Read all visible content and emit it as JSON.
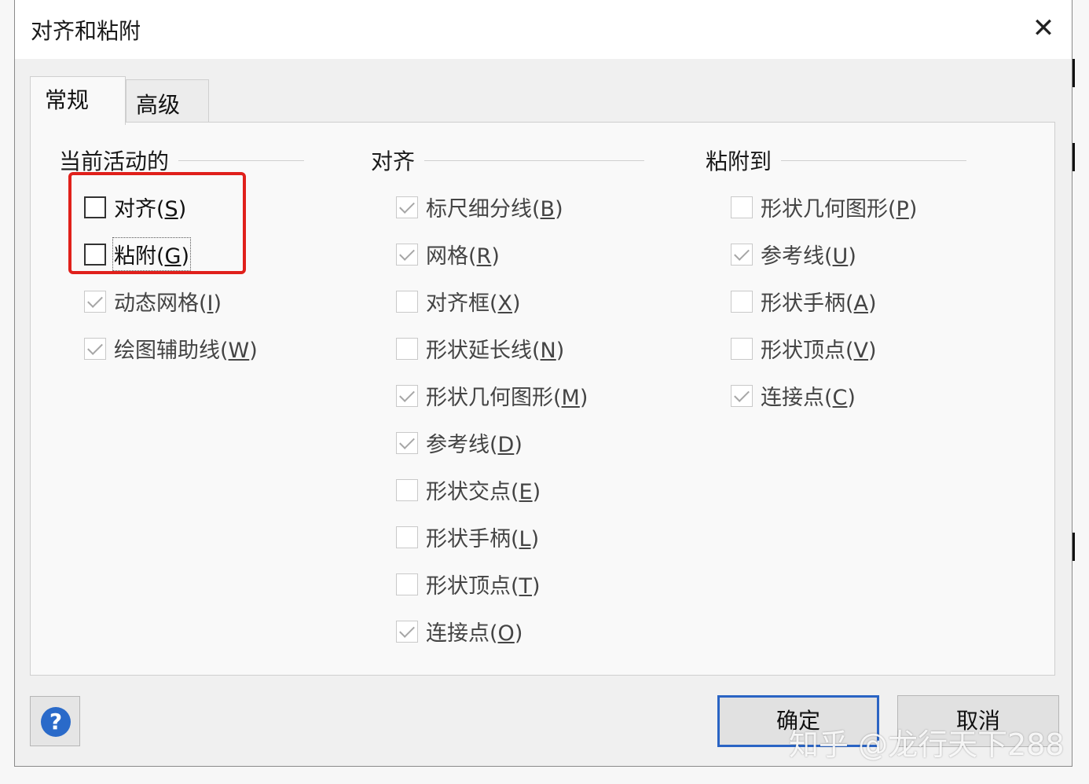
{
  "dialog": {
    "title": "对齐和粘附",
    "close_glyph": "✕"
  },
  "tabs": [
    {
      "label": "常规",
      "active": true
    },
    {
      "label": "高级",
      "active": false
    }
  ],
  "groups": {
    "current": {
      "header": "当前活动的",
      "items": [
        {
          "label": "对齐",
          "key": "S",
          "checked": false
        },
        {
          "label": "粘附",
          "key": "G",
          "checked": false
        },
        {
          "label": "动态网格",
          "key": "I",
          "checked": true
        },
        {
          "label": "绘图辅助线",
          "key": "W",
          "checked": true
        }
      ]
    },
    "align": {
      "header": "对齐",
      "items": [
        {
          "label": "标尺细分线",
          "key": "B",
          "checked": true
        },
        {
          "label": "网格",
          "key": "R",
          "checked": true
        },
        {
          "label": "对齐框",
          "key": "X",
          "checked": false
        },
        {
          "label": "形状延长线",
          "key": "N",
          "checked": false
        },
        {
          "label": "形状几何图形",
          "key": "M",
          "checked": true
        },
        {
          "label": "参考线",
          "key": "D",
          "checked": true
        },
        {
          "label": "形状交点",
          "key": "E",
          "checked": false
        },
        {
          "label": "形状手柄",
          "key": "L",
          "checked": false
        },
        {
          "label": "形状顶点",
          "key": "T",
          "checked": false
        },
        {
          "label": "连接点",
          "key": "O",
          "checked": true
        }
      ]
    },
    "glue": {
      "header": "粘附到",
      "items": [
        {
          "label": "形状几何图形",
          "key": "P",
          "checked": false
        },
        {
          "label": "参考线",
          "key": "U",
          "checked": true
        },
        {
          "label": "形状手柄",
          "key": "A",
          "checked": false
        },
        {
          "label": "形状顶点",
          "key": "V",
          "checked": false
        },
        {
          "label": "连接点",
          "key": "C",
          "checked": true
        }
      ]
    }
  },
  "footer": {
    "help_glyph": "?",
    "ok_label": "确定",
    "cancel_label": "取消"
  },
  "watermark": "知乎 @龙行天下288",
  "colors": {
    "highlight": "#e0201b",
    "focus_border": "#2a64c4",
    "help_icon": "#2a6ac9"
  }
}
